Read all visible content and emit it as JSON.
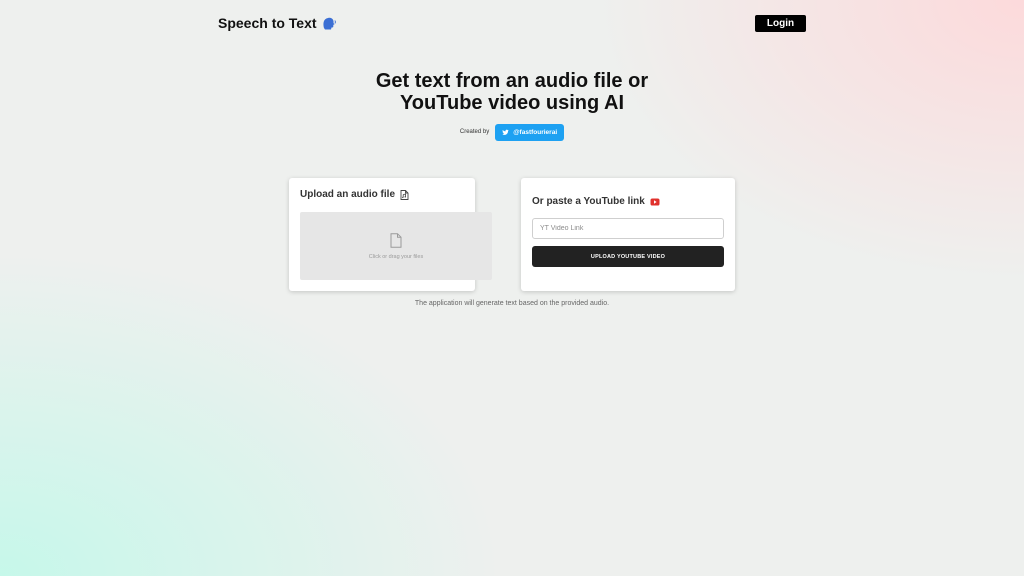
{
  "header": {
    "brand_title": "Speech to Text",
    "brand_icon": "speaking-head-icon",
    "login_label": "Login"
  },
  "hero": {
    "title_line1": "Get text from an audio file or",
    "title_line2": "YouTube video using AI",
    "created_by_label": "Created by",
    "twitter_handle": "@fastfourierai",
    "twitter_icon": "twitter-bird-icon"
  },
  "upload_card": {
    "title": "Upload an audio file",
    "title_icon": "file-audio-icon",
    "dropzone_icon": "file-icon",
    "dropzone_text": "Click or drag your files"
  },
  "youtube_card": {
    "title": "Or paste a YouTube link",
    "title_icon": "youtube-icon",
    "input_value": "",
    "input_placeholder": "YT Video Link",
    "button_label": "UPLOAD YOUTUBE VIDEO"
  },
  "footnote": "The application will generate text based on the provided audio.",
  "colors": {
    "twitter_blue": "#1da1f2",
    "youtube_red": "#e0312d",
    "button_dark": "#222222",
    "login_black": "#000000"
  }
}
